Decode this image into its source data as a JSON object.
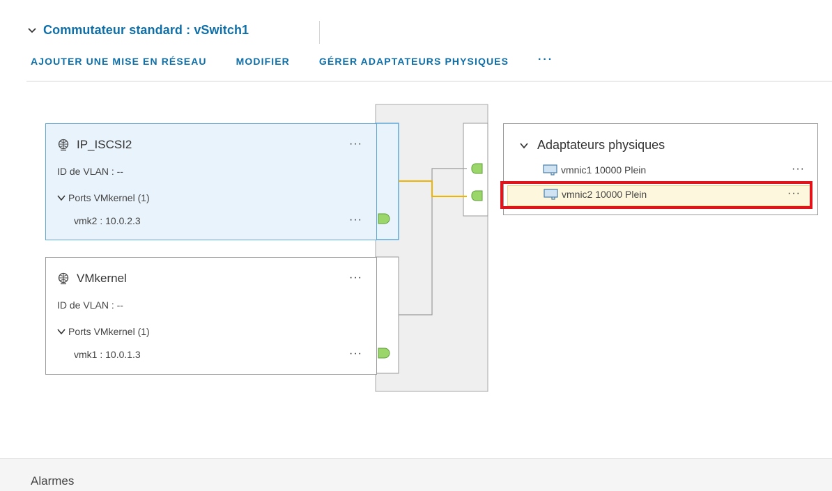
{
  "header": {
    "title": "Commutateur standard : vSwitch1"
  },
  "toolbar": {
    "add_networking": "AJOUTER UNE MISE EN RÉSEAU",
    "edit": "MODIFIER",
    "manage_physical_adapters": "GÉRER ADAPTATEURS PHYSIQUES",
    "more": "···"
  },
  "port_groups": [
    {
      "name": "IP_ISCSI2",
      "vlan": "ID de VLAN : --",
      "ports_label": "Ports VMkernel (1)",
      "vmk": "vmk2 : 10.0.2.3",
      "more": "···",
      "selected": true
    },
    {
      "name": "VMkernel",
      "vlan": "ID de VLAN : --",
      "ports_label": "Ports VMkernel (1)",
      "vmk": "vmk1 : 10.0.1.3",
      "more": "···",
      "selected": false
    }
  ],
  "physical_adapters": {
    "title": "Adaptateurs physiques",
    "items": [
      {
        "label": "vmnic1 10000 Plein",
        "more": "···",
        "highlighted": false
      },
      {
        "label": "vmnic2 10000 Plein",
        "more": "···",
        "highlighted": true
      }
    ]
  },
  "footer": {
    "alarms": "Alarmes"
  },
  "colors": {
    "accent": "#0f6fa8",
    "active_link": "#f0b400",
    "port": "#9bd66a",
    "highlight_box": "#e1141c"
  }
}
